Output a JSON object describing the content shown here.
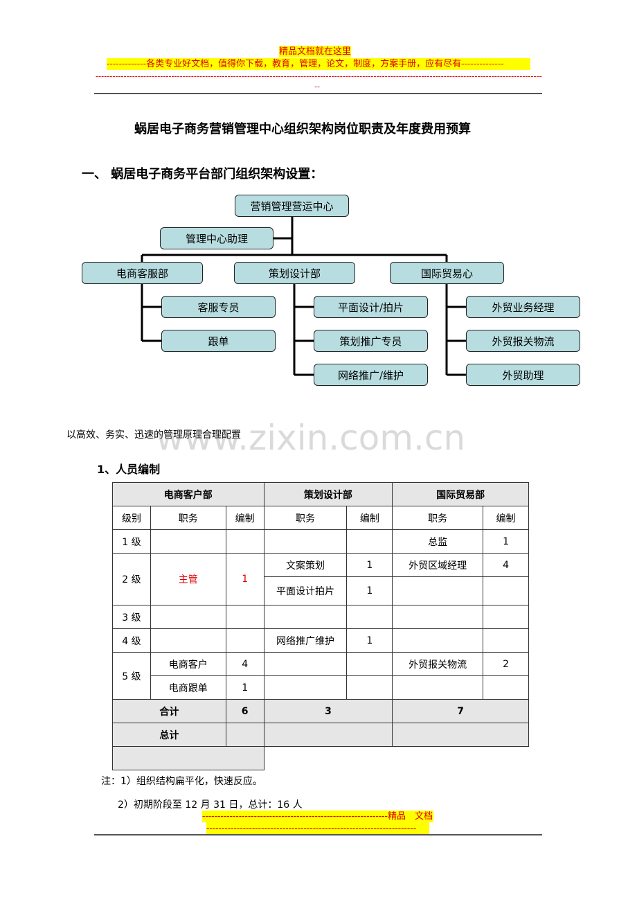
{
  "header": {
    "banner_line1": "精品文档就在这里",
    "banner_line2": "-------------各类专业好文档，值得你下载，教育，管理，论文，制度，方案手册，应有尽有--------------",
    "dash_line": "------------------------------------------------------------------------------------------------------------------------------------------------------------------------",
    "dash_tail": "--"
  },
  "doc": {
    "title": "蜗居电子商务营销管理中心组织架构岗位职责及年度费用预算",
    "section1": "一、   蜗居电子商务平台部门组织架构设置：",
    "principle": "以高效、务实、迅速的管理原理合理配置",
    "watermark": "www.zixin.com.cn",
    "sub1": "1、人员编制"
  },
  "org": {
    "top": "营销管理营运中心",
    "assistant": "管理中心助理",
    "dept1": "电商客服部",
    "dept2": "策划设计部",
    "dept3": "国际贸易心",
    "d1": [
      "客服专员",
      "跟单"
    ],
    "d2": [
      "平面设计/拍片",
      "策划推广专员",
      "网络推广/维护"
    ],
    "d3": [
      "外贸业务经理",
      "外贸报关物流",
      "外贸助理"
    ]
  },
  "table": {
    "depts": [
      "电商客户部",
      "策划设计部",
      "国际贸易部"
    ],
    "cols": [
      "级别",
      "职务",
      "编制",
      "职务",
      "编制",
      "职务",
      "编制"
    ],
    "levels": [
      "1 级",
      "2 级",
      "3 级",
      "4 级",
      "5 级"
    ],
    "r1": {
      "d3_pos": "总监",
      "d3_n": "1"
    },
    "r2": {
      "d1_pos": "主管",
      "d1_n": "1",
      "d2_pos_a": "文案策划",
      "d2_n_a": "1",
      "d2_pos_b": "平面设计拍片",
      "d2_n_b": "1",
      "d3_pos": "外贸区域经理",
      "d3_n": "4"
    },
    "r4": {
      "d2_pos": "网络推广维护",
      "d2_n": "1"
    },
    "r5": {
      "d1_pos_a": "电商客户",
      "d1_n_a": "4",
      "d1_pos_b": "电商跟单",
      "d1_n_b": "1",
      "d3_pos": "外贸报关物流",
      "d3_n": "2"
    },
    "subtotal_label": "合计",
    "subtotal": [
      "6",
      "3",
      "7"
    ],
    "total_label": "总计"
  },
  "notes": [
    "注：1）组织结构扁平化，快速反应。",
    "2）初期阶段至 12 月 31 日，总计：16 人"
  ],
  "footer": {
    "line1": "-------------------------------------------------------------精品　文档",
    "line2": "---------------------------------------------------------------------"
  }
}
